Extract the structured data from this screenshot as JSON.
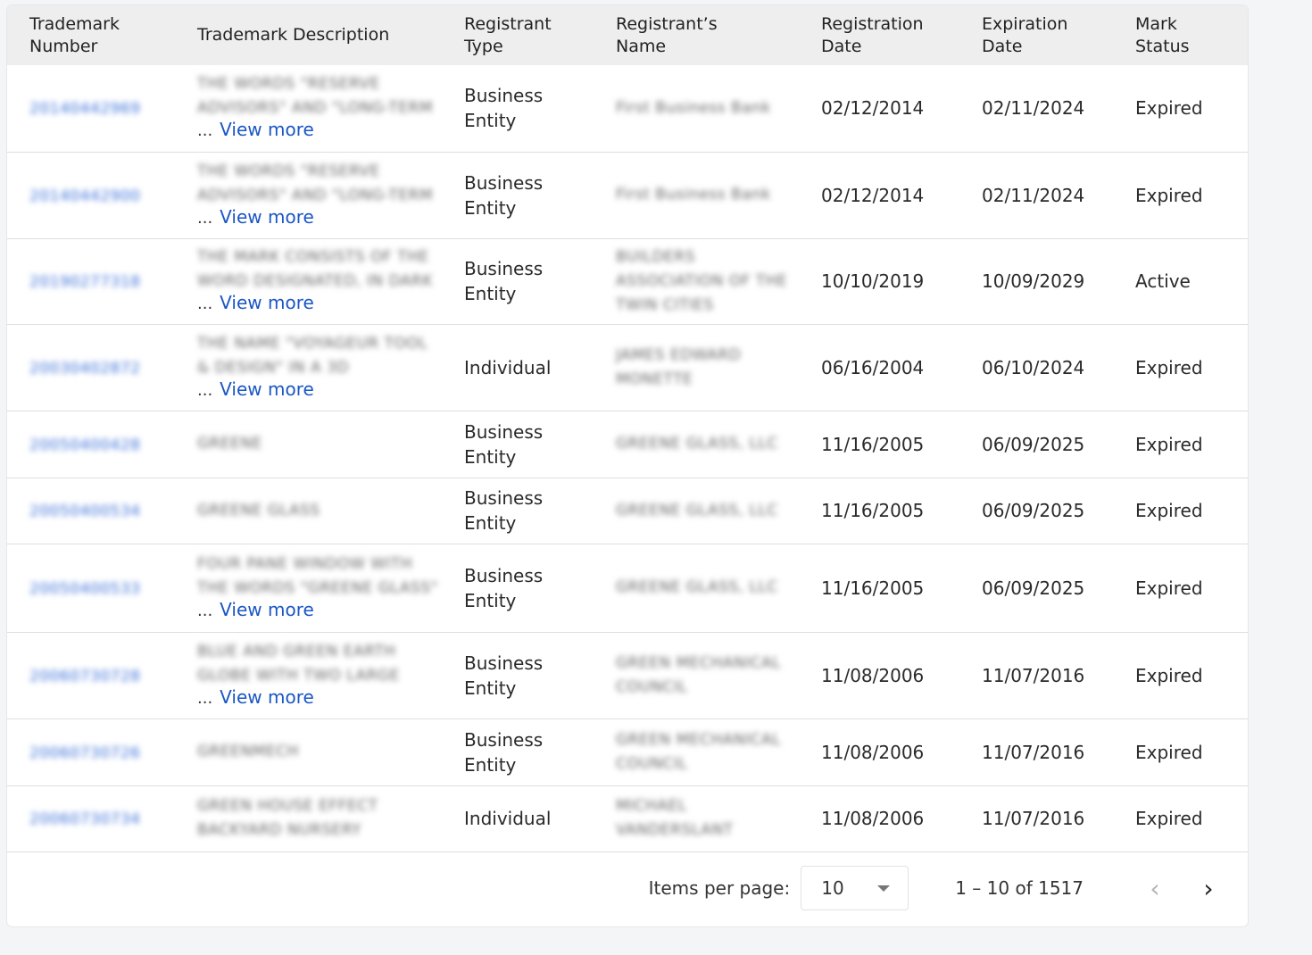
{
  "columns": [
    "Trademark\nNumber",
    "Trademark Description",
    "Registrant\nType",
    "Registrant’s\nName",
    "Registration\nDate",
    "Expiration\nDate",
    "Mark\nStatus"
  ],
  "view_more_label": "View more",
  "ellipsis": "...",
  "rows": [
    {
      "number": "20140442969",
      "desc": [
        "THE WORDS \"RESERVE",
        "ADVISORS\" AND \"LONG-TERM"
      ],
      "view_more": true,
      "type": "Business\nEntity",
      "name": "First Business Bank",
      "reg": "02/12/2014",
      "exp": "02/11/2024",
      "status": "Expired"
    },
    {
      "number": "20140442900",
      "desc": [
        "THE WORDS \"RESERVE",
        "ADVISORS\" AND \"LONG-TERM"
      ],
      "view_more": true,
      "type": "Business\nEntity",
      "name": "First Business Bank",
      "reg": "02/12/2014",
      "exp": "02/11/2024",
      "status": "Expired"
    },
    {
      "number": "20190277318",
      "desc": [
        "THE MARK CONSISTS OF THE",
        "WORD DESIGNATED, IN DARK"
      ],
      "view_more": true,
      "type": "Business\nEntity",
      "name": "BUILDERS ASSOCIATION OF THE TWIN CITIES",
      "reg": "10/10/2019",
      "exp": "10/09/2029",
      "status": "Active"
    },
    {
      "number": "20030402872",
      "desc": [
        "THE NAME \"VOYAGEUR TOOL",
        "& DESIGN\" IN A 3D"
      ],
      "view_more": true,
      "type": "Individual",
      "name": "JAMES EDWARD MONETTE",
      "reg": "06/16/2004",
      "exp": "06/10/2024",
      "status": "Expired"
    },
    {
      "number": "20050400428",
      "desc": [
        "GREENE"
      ],
      "view_more": false,
      "type": "Business\nEntity",
      "name": "GREENE GLASS, LLC",
      "reg": "11/16/2005",
      "exp": "06/09/2025",
      "status": "Expired"
    },
    {
      "number": "20050400534",
      "desc": [
        "GREENE GLASS"
      ],
      "view_more": false,
      "type": "Business\nEntity",
      "name": "GREENE GLASS, LLC",
      "reg": "11/16/2005",
      "exp": "06/09/2025",
      "status": "Expired"
    },
    {
      "number": "20050400533",
      "desc": [
        "FOUR PANE WINDOW WITH",
        "THE WORDS \"GREENE GLASS\""
      ],
      "view_more": true,
      "type": "Business\nEntity",
      "name": "GREENE GLASS, LLC",
      "reg": "11/16/2005",
      "exp": "06/09/2025",
      "status": "Expired"
    },
    {
      "number": "20060730728",
      "desc": [
        "BLUE AND GREEN EARTH",
        "GLOBE WITH TWO LARGE"
      ],
      "view_more": true,
      "type": "Business\nEntity",
      "name": "GREEN MECHANICAL COUNCIL",
      "reg": "11/08/2006",
      "exp": "11/07/2016",
      "status": "Expired"
    },
    {
      "number": "20060730726",
      "desc": [
        "GREENMECH"
      ],
      "view_more": false,
      "type": "Business\nEntity",
      "name": "GREEN MECHANICAL COUNCIL",
      "reg": "11/08/2006",
      "exp": "11/07/2016",
      "status": "Expired"
    },
    {
      "number": "20060730734",
      "desc": [
        "GREEN HOUSE EFFECT",
        "BACKYARD NURSERY"
      ],
      "view_more": false,
      "type": "Individual",
      "name": "MICHAEL VANDERSLANT",
      "reg": "11/08/2006",
      "exp": "11/07/2016",
      "status": "Expired"
    }
  ],
  "paginator": {
    "items_per_page_label": "Items per page:",
    "items_per_page_value": "10",
    "range_label": "1 – 10 of 1517"
  }
}
